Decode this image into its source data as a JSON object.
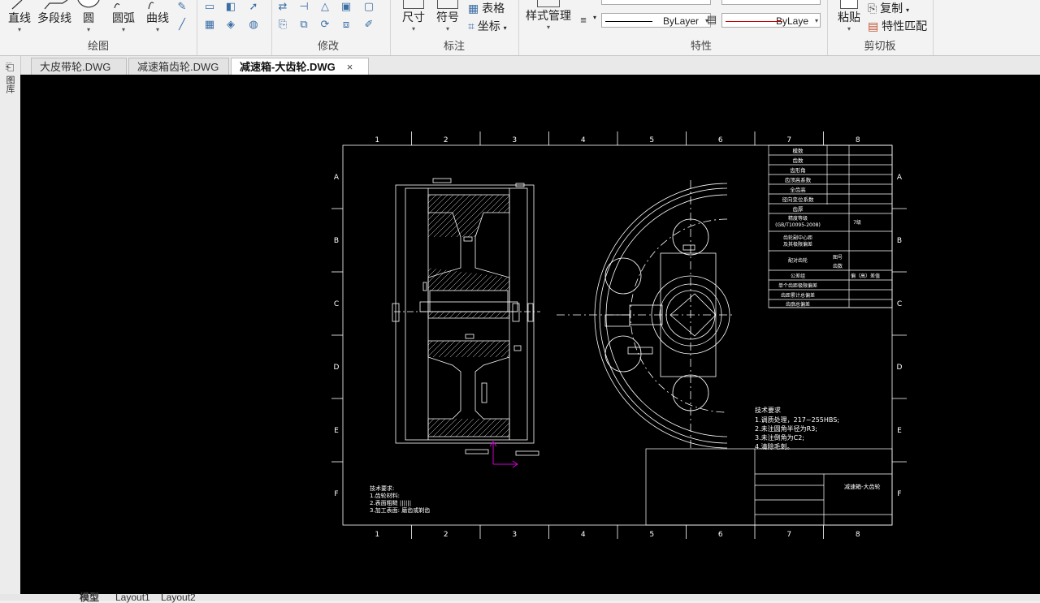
{
  "ribbon": {
    "draw_group": {
      "label": "绘图",
      "buttons": [
        "直线",
        "多段线",
        "圆",
        "圆弧",
        "曲线"
      ]
    },
    "modify_group": {
      "label": "修改"
    },
    "annotate_group": {
      "label": "标注",
      "dimension": "尺寸",
      "symbol": "符号",
      "table": "表格",
      "coordinate": "坐标"
    },
    "style_group": {
      "label": "样式管理"
    },
    "properties_group": {
      "label": "特性",
      "linetype_value": "ByLayer",
      "lineweight_value": "ByLaye"
    },
    "clipboard_group": {
      "label": "剪切板",
      "paste": "粘贴",
      "copy": "复制",
      "match_properties": "特性匹配"
    }
  },
  "tabs": [
    {
      "label": "大皮带轮.DWG",
      "active": false
    },
    {
      "label": "减速箱齿轮.DWG",
      "active": false
    },
    {
      "label": "减速箱-大齿轮.DWG",
      "active": true
    }
  ],
  "close_symbol": "×",
  "left_panel_label": "图库",
  "layout_tabs": [
    "模型",
    "Layout1",
    "Layout2"
  ],
  "drawing": {
    "col_numbers": [
      "1",
      "2",
      "3",
      "4",
      "5",
      "6",
      "7",
      "8"
    ],
    "row_letters": [
      "A",
      "B",
      "C",
      "D",
      "E",
      "F"
    ],
    "param_table": [
      "模数",
      "齿数",
      "齿形角",
      "齿顶高系数",
      "全齿高",
      "径向变位系数",
      "齿厚",
      "精度等级",
      "(GB/T10095-2008)",
      "7级",
      "齿轮副中心距",
      "及其极限偏差",
      "配对齿轮",
      "图号",
      "齿数",
      "公差组",
      "偏（高）差值",
      "单个齿距极限偏差",
      "齿距累计总偏差",
      "齿廓总偏差"
    ],
    "tech_req_title": "技术要求",
    "tech_req_lines": [
      "1.调质处理，217~255HBS;",
      "2.未注圆角半径为R3;",
      "3.未注倒角为C2;",
      "4.清除毛刺。"
    ],
    "note_title": "技术要求:",
    "note_lines": [
      "1.齿轮材料:",
      "2.表面粗糙 ||||||",
      "3.加工表面: 磨齿或剃齿"
    ],
    "title_block_name": "减速箱-大齿轮"
  }
}
